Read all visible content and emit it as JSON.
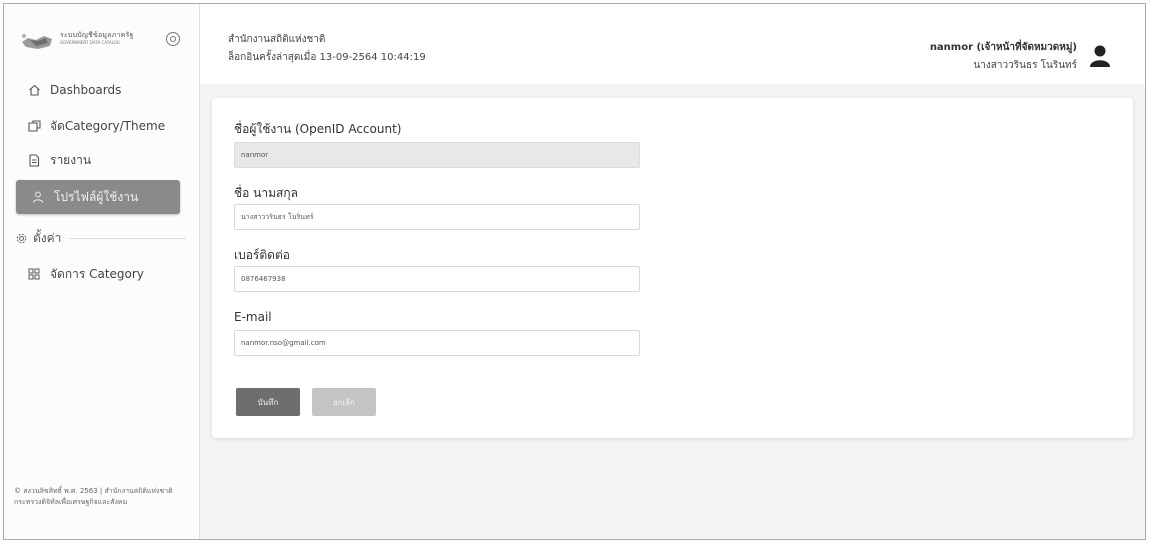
{
  "brand": {
    "name": "ระบบบัญชีข้อมูลภาครัฐ",
    "subtitle": "GOVERNMENT DATA CATALOG"
  },
  "sidebar": {
    "items": [
      {
        "label": "Dashboards",
        "icon": "home-icon"
      },
      {
        "label": "จัดCategory/Theme",
        "icon": "folder-icon"
      },
      {
        "label": "รายงาน",
        "icon": "document-icon"
      },
      {
        "label": "โปรไฟล์ผู้ใช้งาน",
        "icon": "user-icon",
        "active": true
      }
    ],
    "section_label": "ตั้งค่า",
    "settings_items": [
      {
        "label": "จัดการ Category",
        "icon": "grid-icon"
      }
    ],
    "footer": "© สงวนลิขสิทธิ์ พ.ศ. 2563 | สำนักงานสถิติแห่งชาติ กระทรวงดิจิทัลเพื่อเศรษฐกิจและสังคม"
  },
  "header": {
    "org_name": "สำนักงานสถิติแห่งชาติ",
    "last_login": "ล็อกอินครั้งล่าสุดเมื่อ 13-09-2564 10:44:19",
    "user_id": "nanmor (เจ้าหน้าที่จัดหมวดหมู่)",
    "user_name": "นางสาววรินธร โนรินทร์"
  },
  "form": {
    "openid_label": "ชื่อผู้ใช้งาน (OpenID Account)",
    "openid_value": "nanmor",
    "fullname_label": "ชื่อ นามสกุล",
    "fullname_value": "นางสาววรินธร โนรินทร์",
    "phone_label": "เบอร์ติดต่อ",
    "phone_value": "0876467938",
    "email_label": "E-mail",
    "email_value": "nanmor.nso@gmail.com",
    "save_label": "บันทึก",
    "cancel_label": "ยกเลิก"
  },
  "colors": {
    "active_nav": "#8a8a8a",
    "save_button": "#6e6e6e",
    "cancel_button": "#c4c4c4",
    "page_bg": "#f4f4f4"
  }
}
